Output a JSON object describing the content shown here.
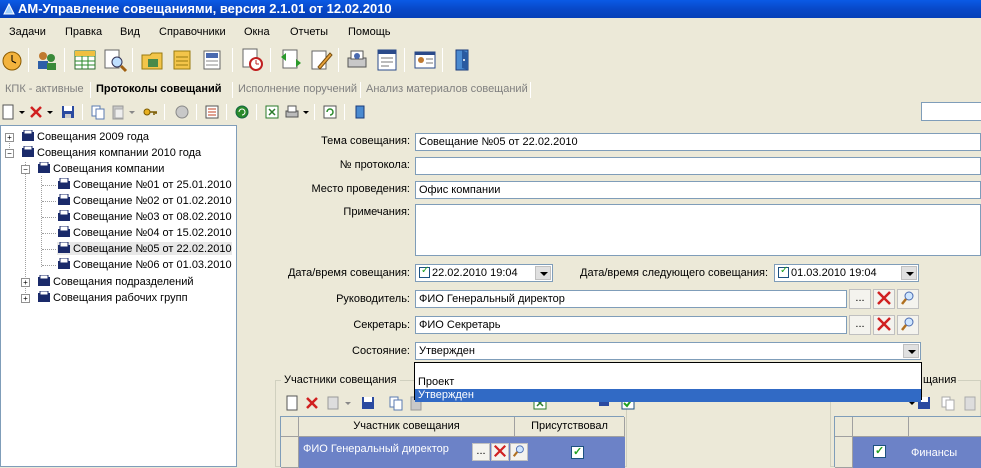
{
  "window": {
    "title": "АМ-Управление совещаниями, версия 2.1.01 от 12.02.2010"
  },
  "menu": [
    "Задачи",
    "Правка",
    "Вид",
    "Справочники",
    "Окна",
    "Отчеты",
    "Помощь"
  ],
  "tabs": [
    "КПК - активные",
    "Протоколы совещаний",
    "Исполнение поручений",
    "Анализ материалов совещаний"
  ],
  "tree": {
    "root1": "Совещания 2009 года",
    "root2": "Совещания компании 2010 года",
    "group1": "Совещания компании",
    "items": [
      "Совещание №01 от 25.01.2010",
      "Совещание №02 от 01.02.2010",
      "Совещание №03 от 08.02.2010",
      "Совещание №04 от 15.02.2010",
      "Совещание №05 от 22.02.2010",
      "Совещание №06 от 01.03.2010"
    ],
    "group2": "Совещания подразделений",
    "group3": "Совещания рабочих групп"
  },
  "form": {
    "topic_label": "Тема совещания:",
    "topic_value": "Совещание №05 от 22.02.2010",
    "protocol_label": "№ протокола:",
    "protocol_value": "",
    "place_label": "Место проведения:",
    "place_value": "Офис компании",
    "notes_label": "Примечания:",
    "notes_value": "",
    "datetime_label": "Дата/время совещания:",
    "datetime_value": "22.02.2010 19:04",
    "next_label": "Дата/время следующего совещания:",
    "next_value": "01.03.2010 19:04",
    "head_label": "Руководитель:",
    "head_value": "ФИО Генеральный директор",
    "secretary_label": "Секретарь:",
    "secretary_value": "ФИО Секретарь",
    "state_label": "Состояние:",
    "state_value": "Утвержден",
    "state_options": [
      "Проект",
      "Утвержден"
    ],
    "ellipsis": "..."
  },
  "participants": {
    "title": "Участники совещания",
    "col_participant": "Участник совещания",
    "col_present": "Присутствовал",
    "rows": [
      {
        "name": "ФИО Генеральный директор"
      }
    ]
  },
  "right_grid": {
    "title_fragment": "щания",
    "row_value": "Финансы"
  }
}
